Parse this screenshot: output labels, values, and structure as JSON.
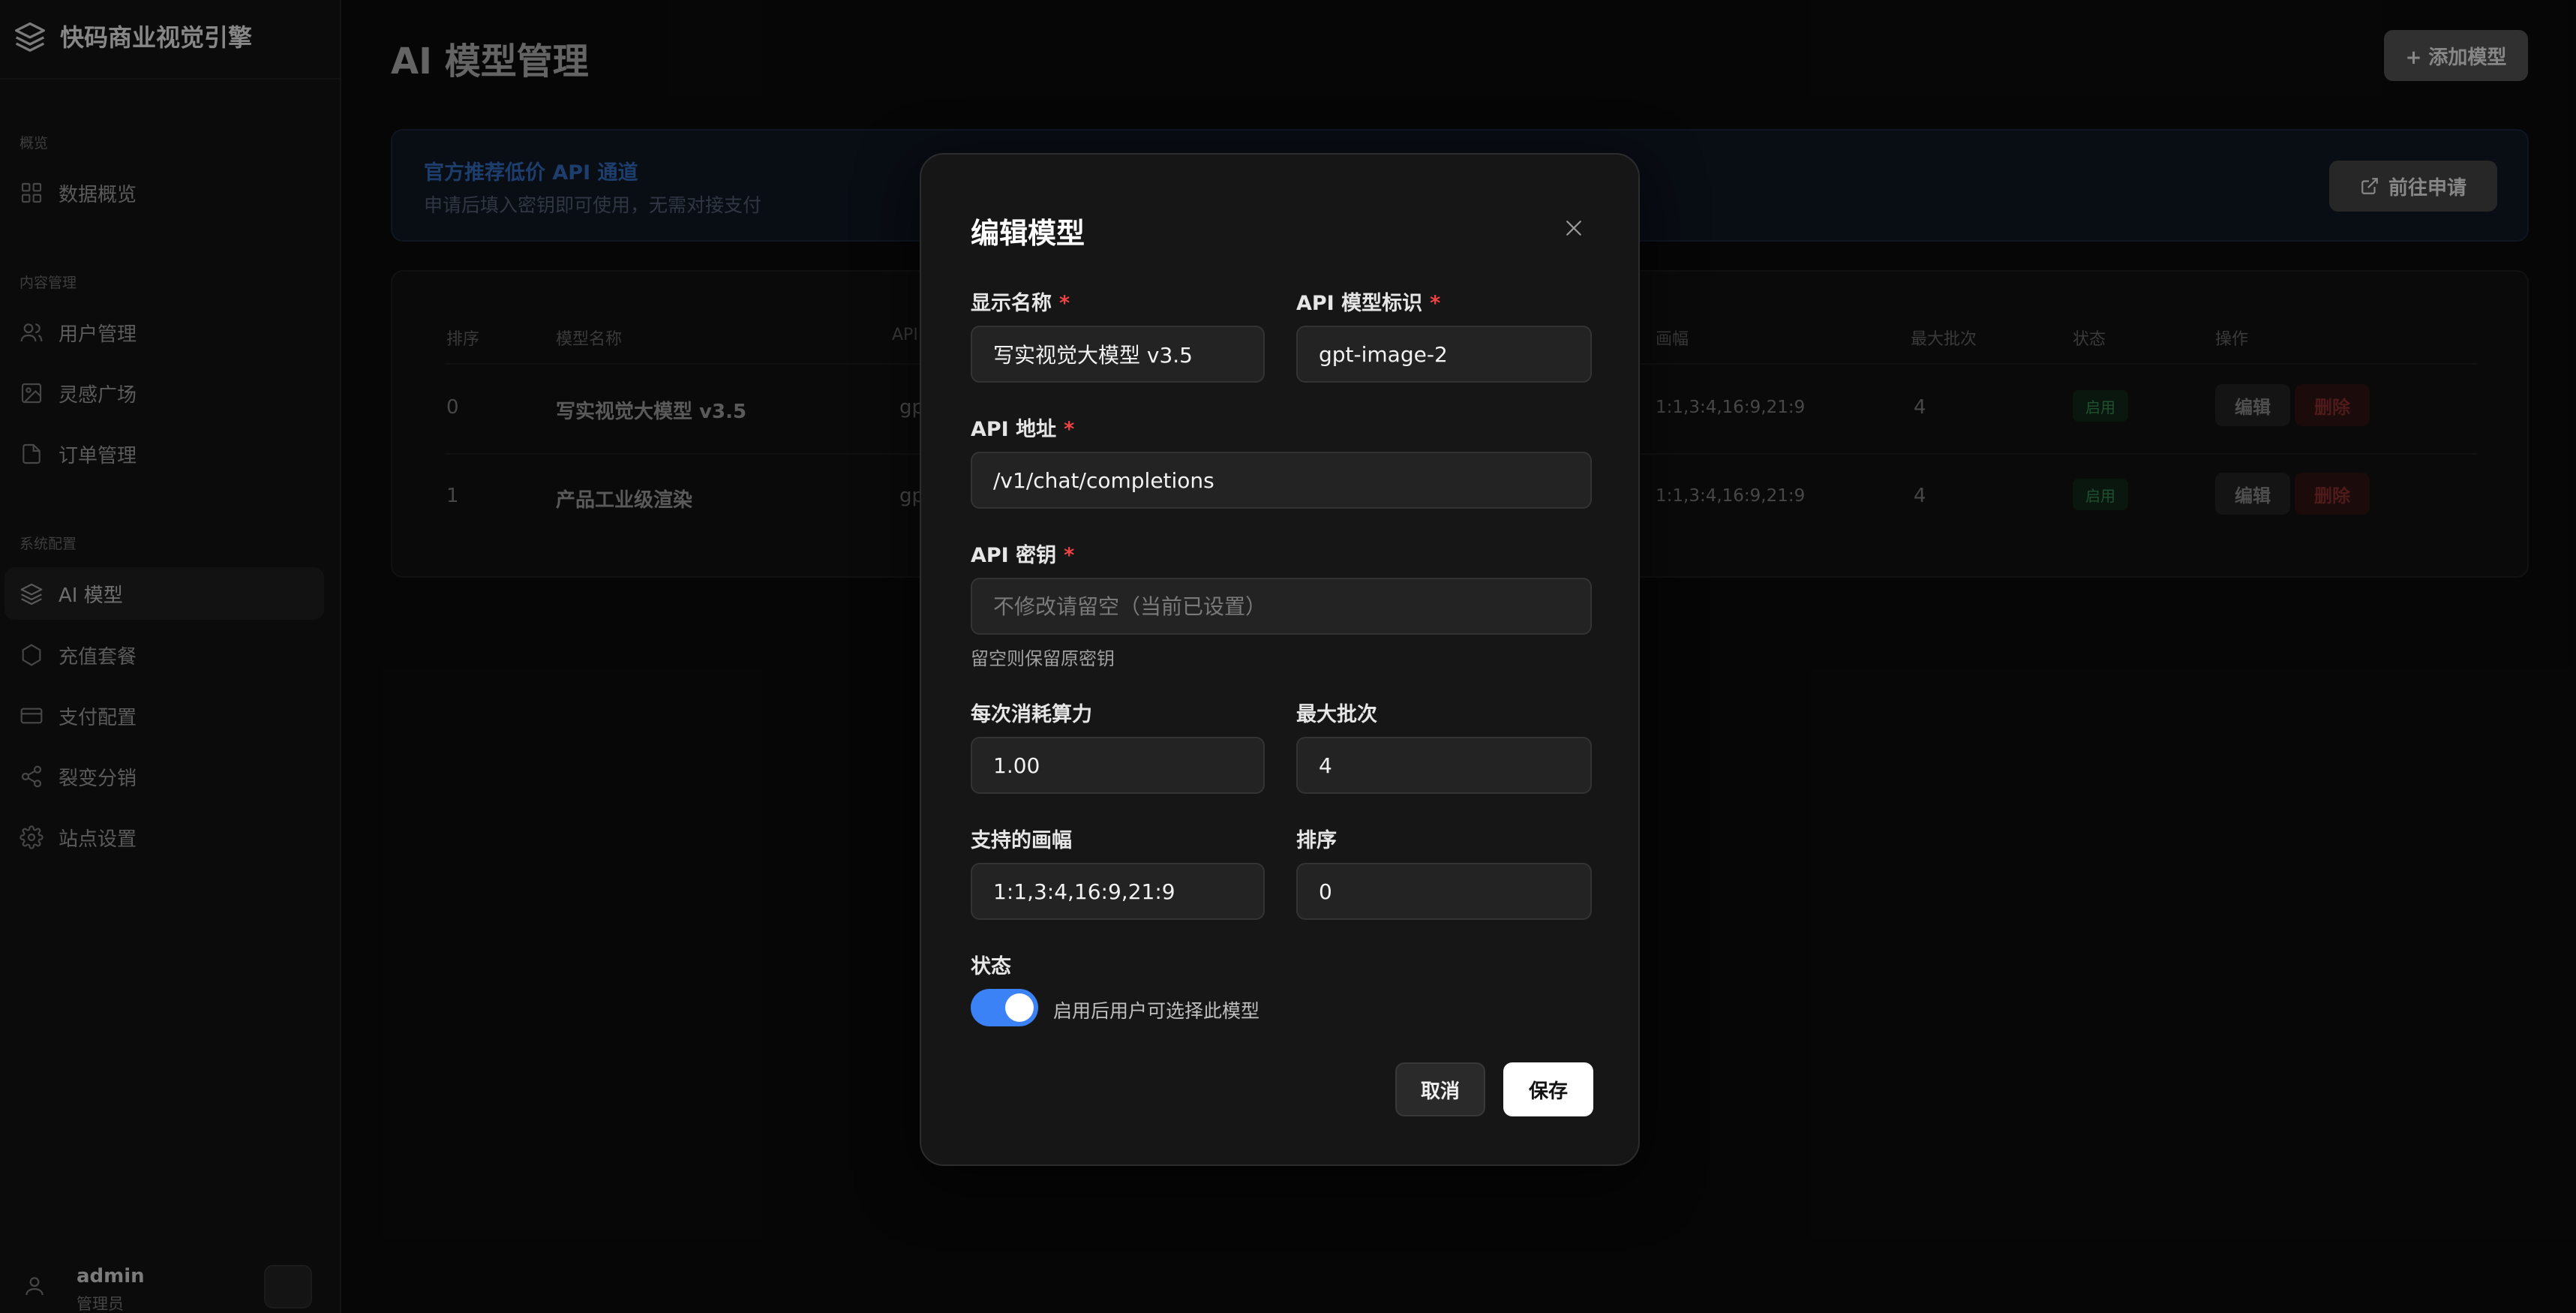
{
  "app": {
    "brand": "快码商业视觉引擎"
  },
  "sidebar": {
    "sections": [
      {
        "label": "概览"
      },
      {
        "label": "内容管理"
      },
      {
        "label": "系统配置"
      }
    ],
    "items": [
      {
        "label": "数据概览",
        "icon": "grid-icon"
      },
      {
        "label": "用户管理",
        "icon": "users-icon"
      },
      {
        "label": "灵感广场",
        "icon": "image-icon"
      },
      {
        "label": "订单管理",
        "icon": "file-icon"
      },
      {
        "label": "AI 模型",
        "icon": "layers-icon",
        "active": true
      },
      {
        "label": "充值套餐",
        "icon": "hexagon-icon"
      },
      {
        "label": "支付配置",
        "icon": "credit-card-icon"
      },
      {
        "label": "裂变分销",
        "icon": "share-icon"
      },
      {
        "label": "站点设置",
        "icon": "gear-icon"
      }
    ],
    "user": {
      "name": "admin",
      "role": "管理员"
    }
  },
  "main": {
    "title": "AI 模型管理",
    "add_button": "+ 添加模型",
    "banner": {
      "title": "官方推荐低价 API 通道",
      "subtitle": "申请后填入密钥即可使用，无需对接支付",
      "button": "前往申请"
    },
    "table": {
      "headers": [
        "排序",
        "模型名称",
        "API",
        "画幅",
        "最大批次",
        "状态",
        "操作"
      ],
      "rows": [
        {
          "order": "0",
          "name": "写实视觉大模型 v3.5",
          "api": "gp",
          "ratios": "1:1,3:4,16:9,21:9",
          "batch": "4",
          "status": "启用",
          "edit": "编辑",
          "delete": "删除"
        },
        {
          "order": "1",
          "name": "产品工业级渲染",
          "api": "gp",
          "ratios": "1:1,3:4,16:9,21:9",
          "batch": "4",
          "status": "启用",
          "edit": "编辑",
          "delete": "删除"
        }
      ]
    }
  },
  "modal": {
    "title": "编辑模型",
    "fields": {
      "display_name": {
        "label": "显示名称",
        "value": "写实视觉大模型 v3.5"
      },
      "api_model_id": {
        "label": "API 模型标识",
        "value": "gpt-image-2"
      },
      "api_url": {
        "label": "API 地址",
        "value": "/v1/chat/completions"
      },
      "api_key": {
        "label": "API 密钥",
        "placeholder": "不修改请留空（当前已设置）",
        "hint": "留空则保留原密钥"
      },
      "cost": {
        "label": "每次消耗算力",
        "value": "1.00"
      },
      "max_batch": {
        "label": "最大批次",
        "value": "4"
      },
      "ratios": {
        "label": "支持的画幅",
        "value": "1:1,3:4,16:9,21:9"
      },
      "sort": {
        "label": "排序",
        "value": "0"
      },
      "status": {
        "label": "状态",
        "hint": "启用后用户可选择此模型",
        "enabled": true
      }
    },
    "required_mark": "*",
    "cancel": "取消",
    "save": "保存"
  },
  "colors": {
    "accent": "#3b82f6",
    "required": "#ef4444",
    "success": "#2f7d4a",
    "danger": "#7a2828"
  }
}
